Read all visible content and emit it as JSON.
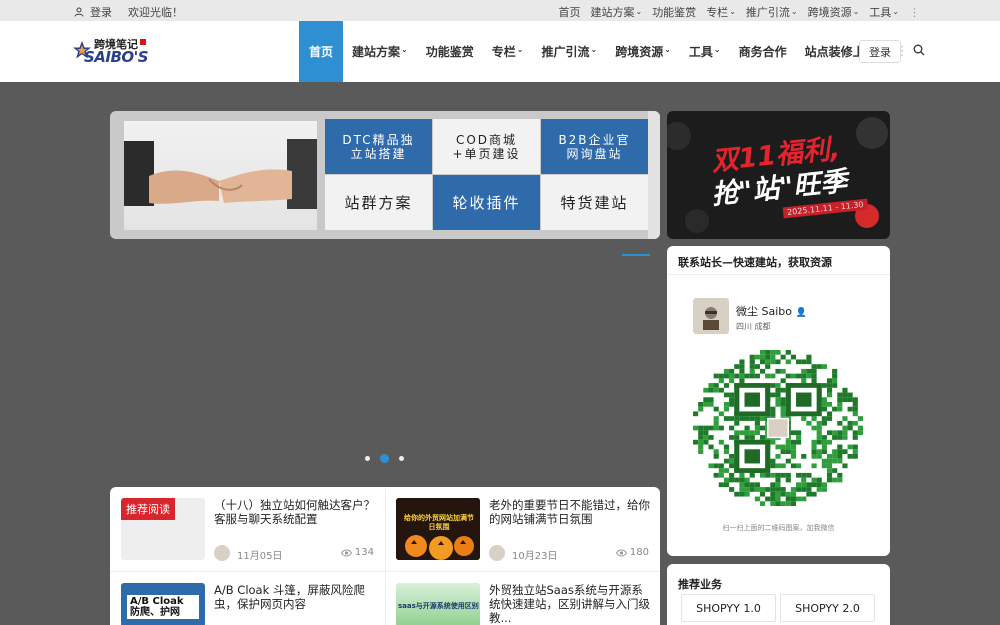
{
  "topbar": {
    "login": "登录",
    "welcome": "欢迎光临！",
    "links": [
      "首页",
      "建站方案",
      "功能鉴赏",
      "专栏",
      "推广引流",
      "跨境资源",
      "工具"
    ]
  },
  "logo": {
    "cn": "跨境笔记",
    "en": "SAIBO'S"
  },
  "nav": {
    "items": [
      "首页",
      "建站方案",
      "功能鉴赏",
      "专栏",
      "推广引流",
      "跨境资源",
      "工具",
      "商务合作",
      "站点装修上品"
    ],
    "login": "登录"
  },
  "banner": {
    "tiles": [
      "DTC精品独立站搭建",
      "COD商城+单页建设",
      "B2B企业官网询盘站",
      "站群方案",
      "轮收插件",
      "特货建站"
    ]
  },
  "promo": {
    "line1": "双11福利,",
    "line2": "抢\"站\"旺季",
    "date": "2025.11.11 - 11.30"
  },
  "contact": {
    "title": "联系站长—快速建站，获取资源",
    "name": "微尘 Saibo",
    "location": "四川 成都",
    "hint": "扫一扫上面的二维码图案，加我微信"
  },
  "business": {
    "title": "推荐业务",
    "buttons": [
      "SHOPYY 1.0",
      "SHOPYY 2.0"
    ]
  },
  "articles": [
    {
      "tag": "推荐阅读",
      "title": "（十八）独立站如何触达客户？客服与聊天系统配置",
      "date": "11月05日",
      "views": "134"
    },
    {
      "title": "老外的重要节日不能错过，给你的网站铺满节日氛围",
      "date": "10月23日",
      "views": "180",
      "thumb_text": "给你的外贸网站加满节日氛围"
    },
    {
      "title": "A/B Cloak 斗篷，屏蔽风险爬虫，保护网页内容",
      "thumb_text": "A/B Cloak 防爬、护网"
    },
    {
      "title": "外贸独立站Saas系统与开源系统快速建站，区别讲解与入门级教...",
      "thumb_text": "saas与开源系统使用区别"
    }
  ],
  "colors": {
    "accent": "#2f8fd3",
    "tag_red": "#d9262c",
    "tile_blue": "#2f6aab"
  }
}
